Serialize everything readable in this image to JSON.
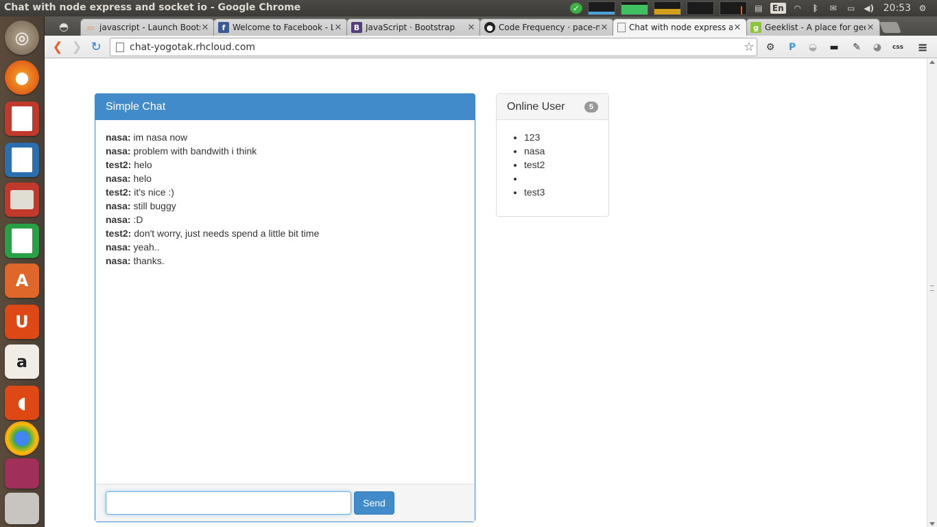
{
  "os": {
    "window_title": "Chat with node express and socket io - Google Chrome",
    "language": "En",
    "clock": "20:53"
  },
  "browser": {
    "tabs": [
      {
        "title": "javascript - Launch Bootst",
        "favicon": "stackoverflow-icon",
        "color": "#f48024"
      },
      {
        "title": "Welcome to Facebook - Lo",
        "favicon": "facebook-icon",
        "color": "#3b5998"
      },
      {
        "title": "JavaScript · Bootstrap",
        "favicon": "bootstrap-icon",
        "color": "#563d7c"
      },
      {
        "title": "Code Frequency · pace-no",
        "favicon": "github-icon",
        "color": "#222222"
      },
      {
        "title": "Chat with node express ar",
        "favicon": "page-icon",
        "color": "#888888",
        "active": true
      },
      {
        "title": "Geeklist - A place for geel",
        "favicon": "geeklist-icon",
        "color": "#8cc63f"
      }
    ],
    "url": "chat-yogotak.rhcloud.com"
  },
  "chat": {
    "title": "Simple Chat",
    "messages": [
      {
        "user": "nasa:",
        "text": "im nasa now"
      },
      {
        "user": "nasa:",
        "text": "problem with bandwith i think"
      },
      {
        "user": "test2:",
        "text": "helo"
      },
      {
        "user": "nasa:",
        "text": "helo"
      },
      {
        "user": "test2:",
        "text": "it's nice :)"
      },
      {
        "user": "nasa:",
        "text": "still buggy"
      },
      {
        "user": "nasa:",
        "text": ":D"
      },
      {
        "user": "test2:",
        "text": "don't worry, just needs spend a little bit time"
      },
      {
        "user": "nasa:",
        "text": "yeah.."
      },
      {
        "user": "nasa:",
        "text": "thanks."
      }
    ],
    "input_value": "",
    "send_label": "Send"
  },
  "online": {
    "title": "Online User",
    "count": "5",
    "users": [
      "123",
      "nasa",
      "test2",
      "",
      "test3"
    ]
  },
  "colors": {
    "primary": "#428bca",
    "panel_border": "#dddddd"
  }
}
